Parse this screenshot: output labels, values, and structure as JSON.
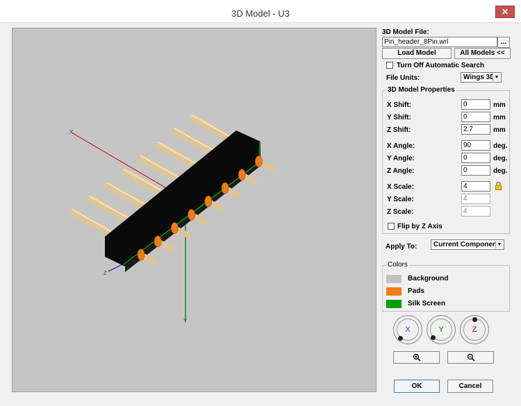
{
  "window": {
    "title": "3D Model - U3",
    "close_glyph": "✕"
  },
  "panel": {
    "model_file_label": "3D Model File:",
    "model_file_value": "Pin_header_8Pin.wrl",
    "browse_label": "...",
    "load_model_label": "Load Model",
    "all_models_label": "All Models <<",
    "turn_off_search_label": "Turn Off Automatic Search",
    "file_units_label": "File Units:",
    "file_units_value": "Wings 3D",
    "properties_title": "3D Model Properties",
    "x_shift_label": "X Shift:",
    "x_shift_value": "0",
    "x_shift_unit": "mm",
    "y_shift_label": "Y Shift:",
    "y_shift_value": "0",
    "y_shift_unit": "mm",
    "z_shift_label": "Z Shift:",
    "z_shift_value": "2.7",
    "z_shift_unit": "mm",
    "x_angle_label": "X Angle:",
    "x_angle_value": "90",
    "x_angle_unit": "deg.",
    "y_angle_label": "Y Angle:",
    "y_angle_value": "0",
    "y_angle_unit": "deg.",
    "z_angle_label": "Z Angle:",
    "z_angle_value": "0",
    "z_angle_unit": "deg.",
    "x_scale_label": "X Scale:",
    "x_scale_value": "4",
    "y_scale_label": "Y Scale:",
    "y_scale_value": "4",
    "z_scale_label": "Z Scale:",
    "z_scale_value": "4",
    "flip_label": "Flip by Z Axis",
    "apply_to_label": "Apply To:",
    "apply_to_value": "Current Component",
    "colors_title": "Colors",
    "background_label": "Background",
    "pads_label": "Pads",
    "silk_label": "Silk Screen",
    "rot_x": "X",
    "rot_y": "Y",
    "rot_z": "Z",
    "ok_label": "OK",
    "cancel_label": "Cancel"
  },
  "viewport": {
    "x_axis_label": "X",
    "y_axis_label": "Y",
    "z_axis_label": "Z"
  },
  "colors": {
    "background": "#c0c0c0",
    "pads": "#f07d14",
    "silk_screen": "#00a000",
    "body": "#0a0a0a",
    "pins": "#dcc597"
  },
  "icons": {
    "lock": "lock-icon",
    "zoom_in": "zoom-in-icon",
    "zoom_out": "zoom-out-icon"
  }
}
